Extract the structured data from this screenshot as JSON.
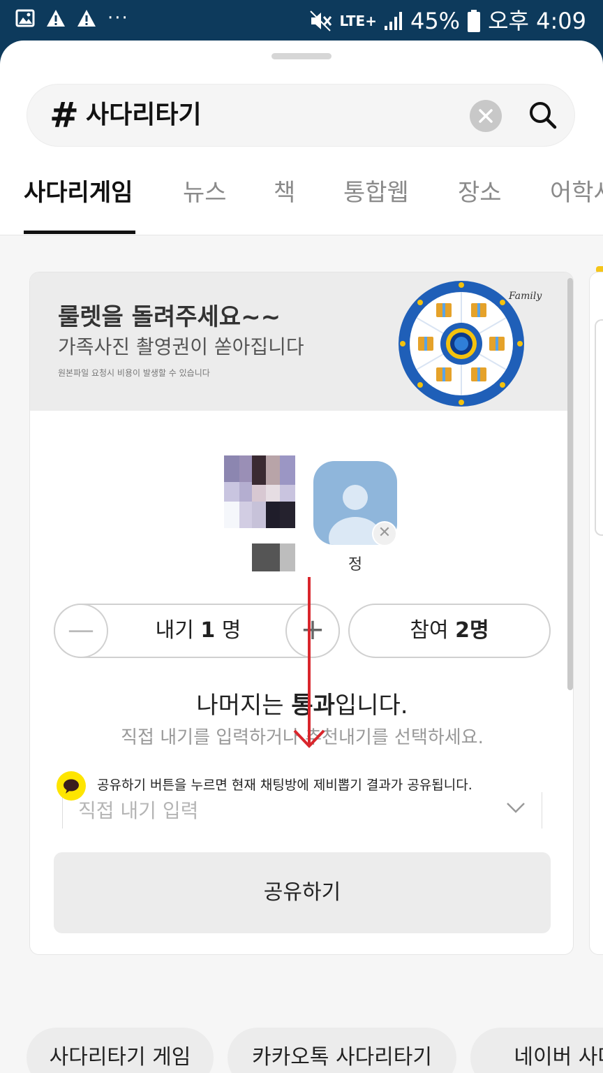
{
  "status_bar": {
    "battery": "45%",
    "time": "오후 4:09",
    "network": "LTE+",
    "overflow": "···",
    "icons": [
      "gallery-icon",
      "alert-icon",
      "alert-icon",
      "mute-icon",
      "signal-icon",
      "battery-icon"
    ]
  },
  "search": {
    "prefix": "#",
    "query": "사다리타기"
  },
  "tabs": [
    {
      "label": "사다리게임",
      "active": true
    },
    {
      "label": "뉴스"
    },
    {
      "label": "책"
    },
    {
      "label": "통합웹"
    },
    {
      "label": "장소"
    },
    {
      "label": "어학사"
    }
  ],
  "card": {
    "banner": {
      "title": "룰렛을 돌려주세요~~",
      "subtitle": "가족사진 촬영권이 쏟아집니다",
      "note": "원본파일 요청시 비용이 발생할 수 있습니다",
      "logo": "Family U"
    },
    "participants": [
      {
        "name": "",
        "avatar": "pixelated-photo"
      },
      {
        "name": "정",
        "avatar": "default-avatar"
      }
    ],
    "stepper": {
      "minus": "—",
      "plus": "+",
      "label_prefix": "내기",
      "count": "1",
      "label_suffix": "명"
    },
    "participants_button": {
      "prefix": "참여",
      "count": "2명"
    },
    "result": {
      "title_part1": "나머지는",
      "title_bold": "통과",
      "title_part2": "입니다.",
      "subtitle": "직접 내기를 입력하거나 추천내기를 선택하세요."
    },
    "share_notice": "공유하기 버튼을 누르면 현재 채팅방에 제비뽑기 결과가 공유됩니다.",
    "direct_input": {
      "placeholder": "직접 내기 입력",
      "value": ""
    },
    "share_button": "공유하기"
  },
  "suggestions": [
    "사다리타기 게임",
    "카카오톡 사다리타기",
    "네이버 사다리"
  ],
  "colors": {
    "status_bar": "#0d3a5c",
    "annotation_arrow": "#d9262c",
    "kakao_yellow": "#fee500",
    "roulette_blue": "#1f5fb8"
  }
}
